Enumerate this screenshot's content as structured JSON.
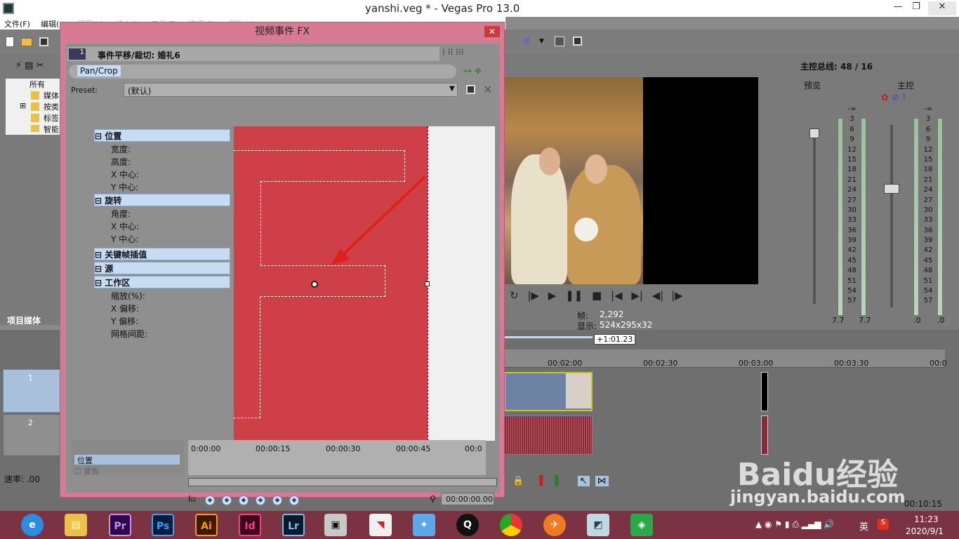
{
  "app": {
    "title": "yanshi.veg * - Vegas Pro 13.0"
  },
  "menu": [
    "文件(F)",
    "编辑(",
    "视图(V)",
    "插入(I)",
    "工具(T)",
    "选项(O)",
    "帮助(H)"
  ],
  "explorer": {
    "items": [
      "所有",
      "媒体",
      "按类",
      "标签",
      "智能"
    ],
    "tab_label": "项目媒体"
  },
  "fx": {
    "window_title": "视频事件 FX",
    "chain_label": "事件平移/裁切: 婚礼6",
    "plugin_tab": "Pan/Crop",
    "preset_label": "Preset:",
    "preset_value": "(默认)",
    "properties": [
      {
        "label": "位置",
        "kind": "category"
      },
      {
        "label": "宽度:",
        "kind": "prop"
      },
      {
        "label": "高度:",
        "kind": "prop"
      },
      {
        "label": "X 中心:",
        "kind": "prop"
      },
      {
        "label": "Y 中心:",
        "kind": "prop"
      },
      {
        "label": "旋转",
        "kind": "category"
      },
      {
        "label": "角度:",
        "kind": "prop"
      },
      {
        "label": "X 中心:",
        "kind": "prop"
      },
      {
        "label": "Y 中心:",
        "kind": "prop"
      },
      {
        "label": "关键帧插值",
        "kind": "category"
      },
      {
        "label": "源",
        "kind": "category"
      },
      {
        "label": "工作区",
        "kind": "category"
      },
      {
        "label": "缩放(%):",
        "kind": "prop"
      },
      {
        "label": "X 偏移:",
        "kind": "prop"
      },
      {
        "label": "Y 偏移:",
        "kind": "prop"
      },
      {
        "label": "网格间距:",
        "kind": "prop"
      }
    ],
    "keyframe_ruler": [
      "0:00:00",
      "00:00:15",
      "00:00:30",
      "00:00:45",
      "00:0"
    ],
    "keyframe_tracks": [
      "位置",
      "蒙板"
    ],
    "time_display": "00:00:00.00"
  },
  "preview": {
    "frame_label": "帧:",
    "frame_value": "2,292",
    "display_label": "显示:",
    "display_value": "524x295x32"
  },
  "mixer": {
    "title": "主控总线: 48 / 16",
    "preview_label": "预览",
    "master_label": "主控",
    "scale": [
      "-∞",
      "3",
      "6",
      "9",
      "12",
      "15",
      "18",
      "21",
      "24",
      "27",
      "30",
      "33",
      "36",
      "39",
      "42",
      "45",
      "48",
      "51",
      "54",
      "57"
    ],
    "bottom_values": [
      "7.7",
      "7.7",
      ".0",
      ".0"
    ]
  },
  "timeline": {
    "cursor_time": "+1:01.23",
    "ruler": [
      "00:02:00",
      "00:02:30",
      "00:03:00",
      "00:03:30",
      "00:0"
    ],
    "track_numbers": [
      "1",
      "2"
    ],
    "rate_label": "速率: .00",
    "end_time": "00:10:15"
  },
  "taskbar": {
    "apps": [
      "Pr",
      "Ps",
      "Ai",
      "Id",
      "Lr"
    ],
    "time": "11:23",
    "date": "2020/9/1",
    "ime": "英",
    "watermark_text": "Baidu经验",
    "watermark_url": "jingyan.baidu.com"
  }
}
